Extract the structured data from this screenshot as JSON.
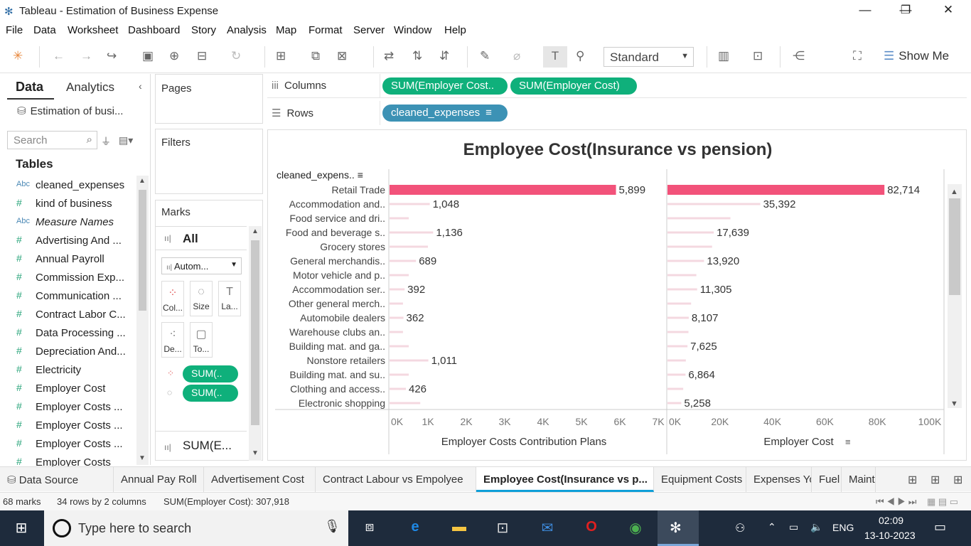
{
  "window": {
    "title": "Tableau - Estimation of Business Expense",
    "controls": [
      "—",
      "❐",
      "✕"
    ]
  },
  "menu": [
    "File",
    "Data",
    "Worksheet",
    "Dashboard",
    "Story",
    "Analysis",
    "Map",
    "Format",
    "Server",
    "Window",
    "Help"
  ],
  "toolbar": {
    "fit_mode": "Standard",
    "show_me": "Show Me"
  },
  "data_pane": {
    "tab_data": "Data",
    "tab_analytics": "Analytics",
    "datasource": "Estimation of busi...",
    "search_placeholder": "Search",
    "tables_header": "Tables",
    "fields": [
      {
        "type": "Abc",
        "name": "cleaned_expenses",
        "italic": false
      },
      {
        "type": "#",
        "name": "kind of business",
        "italic": false
      },
      {
        "type": "Abc",
        "name": "Measure Names",
        "italic": true
      },
      {
        "type": "#",
        "name": "Advertising And ...",
        "italic": false
      },
      {
        "type": "#",
        "name": "Annual Payroll",
        "italic": false
      },
      {
        "type": "#",
        "name": "Commission Exp...",
        "italic": false
      },
      {
        "type": "#",
        "name": "Communication ...",
        "italic": false
      },
      {
        "type": "#",
        "name": "Contract Labor C...",
        "italic": false
      },
      {
        "type": "#",
        "name": "Data Processing ...",
        "italic": false
      },
      {
        "type": "#",
        "name": "Depreciation And...",
        "italic": false
      },
      {
        "type": "#",
        "name": "Electricity",
        "italic": false
      },
      {
        "type": "#",
        "name": "Employer Cost",
        "italic": false
      },
      {
        "type": "#",
        "name": "Employer Costs ...",
        "italic": false
      },
      {
        "type": "#",
        "name": "Employer Costs ...",
        "italic": false
      },
      {
        "type": "#",
        "name": "Employer Costs ...",
        "italic": false
      },
      {
        "type": "#",
        "name": "Employer Costs",
        "italic": false
      }
    ]
  },
  "pages": {
    "title": "Pages"
  },
  "filters": {
    "title": "Filters"
  },
  "marks": {
    "title": "Marks",
    "all": "All",
    "mark_type": "Autom...",
    "buttons": [
      "Col...",
      "Size",
      "La...",
      "De...",
      "To..."
    ],
    "pills": [
      "SUM(..",
      "SUM(.."
    ],
    "bottom": "SUM(E..."
  },
  "shelves": {
    "columns_label": "Columns",
    "rows_label": "Rows",
    "columns_pills": [
      "SUM(Employer Cost..",
      "SUM(Employer Cost)"
    ],
    "rows_pills": [
      "cleaned_expenses"
    ]
  },
  "chart_data": {
    "type": "bar",
    "title": "Employee Cost(Insurance vs pension)",
    "row_header": "cleaned_expens..",
    "categories": [
      "Retail Trade",
      "Accommodation and..",
      "Food service and dri..",
      "Food and beverage s..",
      "Grocery stores",
      "General merchandis..",
      "Motor vehicle and p..",
      "Accommodation ser..",
      "Other general merch..",
      "Automobile dealers",
      "Warehouse clubs an..",
      "Building mat. and ga..",
      "Nonstore retailers",
      "Building mat. and su..",
      "Clothing and access..",
      "Electronic shopping"
    ],
    "series": [
      {
        "name": "Employer Costs Contribution Plans",
        "values": [
          5899,
          1048,
          500,
          1136,
          1000,
          689,
          500,
          392,
          350,
          362,
          350,
          500,
          1011,
          500,
          426,
          800
        ],
        "labels": [
          "5,899",
          "1,048",
          "",
          "1,136",
          "",
          "689",
          "",
          "392",
          "",
          "362",
          "",
          "",
          "1,011",
          "",
          "426",
          ""
        ],
        "xlim": [
          0,
          7000
        ],
        "ticks": [
          "0K",
          "1K",
          "2K",
          "3K",
          "4K",
          "5K",
          "6K",
          "7K"
        ],
        "xlabel": "Employer Costs Contribution Plans"
      },
      {
        "name": "Employer Cost",
        "values": [
          82714,
          35392,
          24000,
          17639,
          17000,
          13920,
          11000,
          11305,
          9000,
          8107,
          8000,
          7625,
          7000,
          6864,
          6000,
          5258
        ],
        "labels": [
          "82,714",
          "35,392",
          "",
          "17,639",
          "",
          "13,920",
          "",
          "11,305",
          "",
          "8,107",
          "",
          "7,625",
          "",
          "6,864",
          "",
          "5,258"
        ],
        "xlim": [
          0,
          100000
        ],
        "ticks": [
          "0K",
          "20K",
          "40K",
          "60K",
          "80K",
          "100K"
        ],
        "xlabel": "Employer Cost"
      }
    ],
    "highlight_color": "#f2527a",
    "bar_color": "#f4d8e0"
  },
  "sheet_tabs": [
    "Data Source",
    "Annual Pay Roll",
    "Advertisement Cost",
    "Contract Labour vs Empolyee",
    "Employee Cost(Insurance vs p...",
    "Equipment Costs",
    "Expenses Yoy",
    "Fuel",
    "Mainte"
  ],
  "active_tab": "Employee Cost(Insurance vs p...",
  "status": {
    "marks": "68 marks",
    "rows": "34 rows by 2 columns",
    "sum": "SUM(Employer Cost): 307,918"
  },
  "taskbar": {
    "search": "Type here to search",
    "lang": "ENG",
    "time": "02:09",
    "date": "13-10-2023"
  }
}
